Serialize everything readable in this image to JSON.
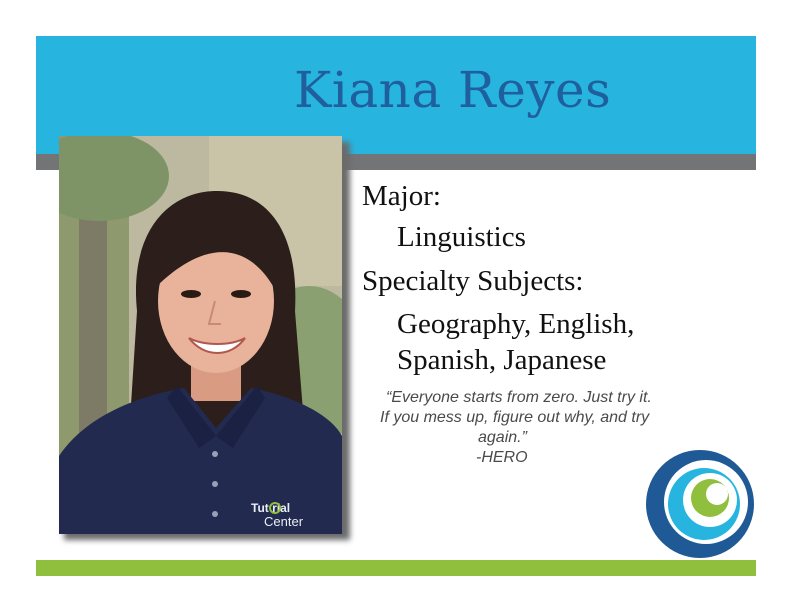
{
  "header": {
    "name": "Kiana Reyes"
  },
  "profile": {
    "major_label": "Major:",
    "major_value": "Linguistics",
    "subjects_label": "Specialty Subjects:",
    "subjects_line1": "Geography, English,",
    "subjects_line2": "Spanish, Japanese"
  },
  "quote": {
    "line1": "“Everyone starts from zero. Just try it.",
    "line2": "If you mess up, figure out why, and try",
    "line3": "again.”",
    "attribution": "-HERO"
  },
  "photo": {
    "shirt_logo_line1": "Tut rial",
    "shirt_logo_line2": "Center"
  },
  "colors": {
    "banner": "#27b5e0",
    "name_text": "#1f5f9e",
    "gray_bar": "#727476",
    "green_bar": "#8fbf3c",
    "logo_navy": "#1f5a96",
    "logo_blue": "#27b5e0",
    "logo_green": "#8fbf3c"
  }
}
